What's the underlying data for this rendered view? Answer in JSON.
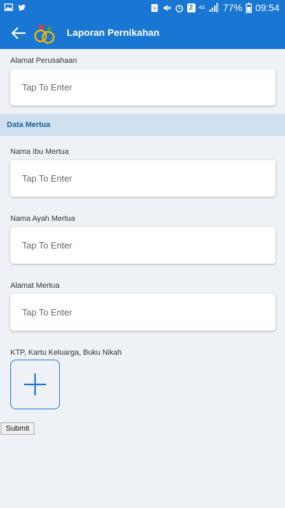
{
  "status_bar": {
    "network": "4G",
    "sim_slot": "2",
    "battery": "77%",
    "time": "09:54",
    "icons": [
      "gallery-icon",
      "twitter-icon",
      "nfc-icon",
      "mute-icon",
      "alarm-icon",
      "signal-icon",
      "battery-icon"
    ]
  },
  "header": {
    "title": "Laporan Pernikahan",
    "color": "#1976d2"
  },
  "form": {
    "company_address": {
      "label": "Alamat Perusahaan",
      "placeholder": "Tap To Enter"
    },
    "section_title": "Data Mertua",
    "mother_in_law": {
      "label": "Nama Ibu Mertua",
      "placeholder": "Tap To Enter"
    },
    "father_in_law": {
      "label": "Nama Ayah Mertua",
      "placeholder": "Tap To Enter"
    },
    "in_law_address": {
      "label": "Alamat Mertua",
      "placeholder": "Tap To Enter"
    },
    "documents_label": "KTP, Kartu Keluarga, Buku Nikah",
    "submit_label": "Submit"
  }
}
